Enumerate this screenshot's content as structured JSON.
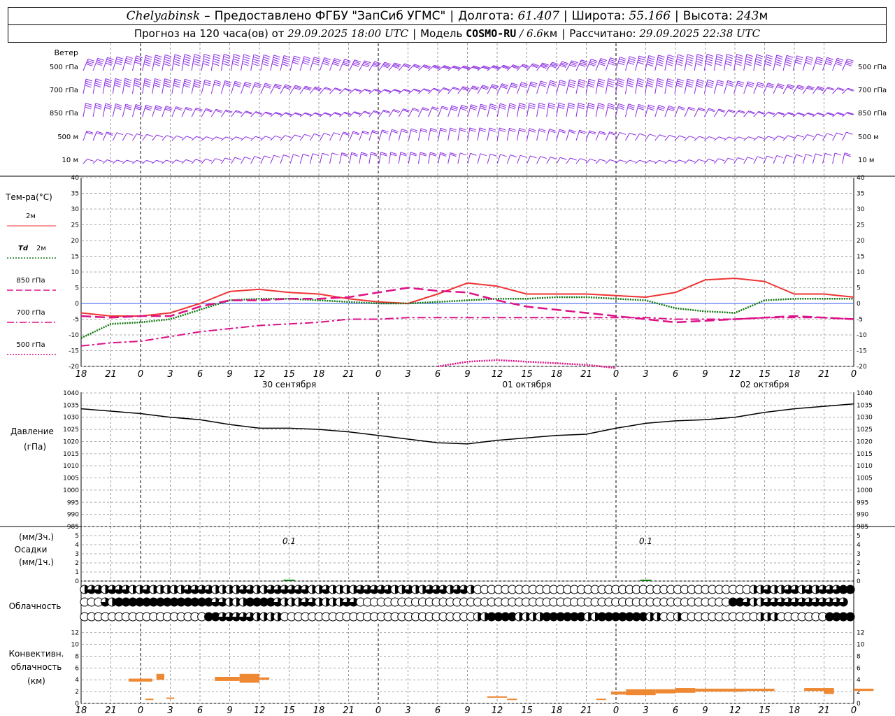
{
  "header": {
    "station": "Chelyabinsk",
    "dash": "–",
    "provider": "Предоставлено ФГБУ \"ЗапСиб УГМС\"",
    "lon_label": "Долгота:",
    "lon_value": "61.407",
    "lat_label": "Широта:",
    "lat_value": "55.166",
    "alt_label": "Высота:",
    "alt_value": "243",
    "alt_unit": "м",
    "forecast_label": "Прогноз на 120 часа(ов) от",
    "forecast_start": "29.09.2025 18:00 UTC",
    "model_label": "Модель",
    "model_name": "COSMO-RU",
    "model_sep": "/",
    "model_res": "6.6",
    "model_res_unit": "км",
    "calc_label": "Рассчитано:",
    "calc_time": "29.09.2025 22:38 UTC"
  },
  "time_axis": {
    "hour_labels": [
      "18",
      "21",
      "0",
      "3",
      "6",
      "9",
      "12",
      "15",
      "18",
      "21",
      "0",
      "3",
      "6",
      "9",
      "12",
      "15",
      "18",
      "21",
      "0",
      "3",
      "6",
      "9",
      "12",
      "15",
      "18",
      "21",
      "0"
    ],
    "dates": [
      "30 сентября",
      "01 октября",
      "02 октября"
    ]
  },
  "wind_panel": {
    "title": "Ветер",
    "levels": [
      {
        "value": "500",
        "unit": "гПа"
      },
      {
        "value": "700",
        "unit": "гПа"
      },
      {
        "value": "850",
        "unit": "гПа"
      },
      {
        "value": "500",
        "unit": "м"
      },
      {
        "value": "10",
        "unit": "м"
      }
    ],
    "color": "#8a2be2"
  },
  "temp_panel": {
    "title": "Тем-ра(°C)",
    "legend": [
      {
        "label": "2м",
        "color": "#ee3333",
        "dash": "solid"
      },
      {
        "label_bold": "Td",
        "label": "2м",
        "color": "#117711",
        "dash": "dotted"
      },
      {
        "label": "850 гПа",
        "color": "#dd1188",
        "dash": "dashed"
      },
      {
        "label": "700 гПа",
        "color": "#dd1188",
        "dash": "dashdot"
      },
      {
        "label": "500 гПа",
        "color": "#dd1188",
        "dash": "dotted"
      }
    ],
    "ticks": [
      "40",
      "35",
      "30",
      "25",
      "20",
      "15",
      "10",
      "5",
      "0",
      "-5",
      "-10",
      "-15",
      "-20"
    ]
  },
  "pressure_panel": {
    "title": "Давление",
    "unit": "(гПа)",
    "ticks": [
      "1040",
      "1035",
      "1030",
      "1025",
      "1020",
      "1015",
      "1010",
      "1005",
      "1000",
      "995",
      "990",
      "985"
    ]
  },
  "precip_panel": {
    "unit_3h": "(мм/3ч.)",
    "title": "Осадки",
    "unit_1h": "(мм/1ч.)",
    "ticks": [
      "5",
      "4",
      "3",
      "2",
      "1",
      "0"
    ],
    "labels": [
      "0.1",
      "0.1"
    ]
  },
  "cloud_panel": {
    "title": "Облачность"
  },
  "conv_panel": {
    "title": "Конвективн.",
    "title2": "облачность",
    "unit": "(км)",
    "ticks": [
      "12",
      "10",
      "8",
      "6",
      "4",
      "2",
      "0"
    ],
    "color": "#ee8833"
  },
  "chart_data": [
    {
      "type": "line",
      "title": "Тем-ра(°C)",
      "x": [
        "18",
        "21",
        "0",
        "3",
        "6",
        "9",
        "12",
        "15",
        "18",
        "21",
        "0",
        "3",
        "6",
        "9",
        "12",
        "15",
        "18",
        "21",
        "0",
        "3",
        "6",
        "9",
        "12",
        "15",
        "18",
        "21",
        "0"
      ],
      "ylim": [
        -20,
        40
      ],
      "series": [
        {
          "name": "2м",
          "values": [
            -3,
            -4,
            -4,
            -3,
            0,
            3.8,
            4.5,
            3.5,
            3,
            1.5,
            0.5,
            0,
            3,
            6.5,
            5.5,
            3,
            3,
            3,
            2.5,
            2,
            3.5,
            7.5,
            8,
            7,
            3,
            3,
            2
          ]
        },
        {
          "name": "Td 2м",
          "values": [
            -11,
            -6.5,
            -6,
            -5,
            -2,
            1,
            1.5,
            1.5,
            1,
            0.5,
            0,
            0,
            0.5,
            1,
            1.5,
            1.5,
            2,
            2,
            1.5,
            1,
            -1.5,
            -2.5,
            -3,
            1,
            1.5,
            1.5,
            1.5
          ]
        },
        {
          "name": "850 гПа",
          "values": [
            -4,
            -4.5,
            -4,
            -4,
            -1,
            1,
            1,
            1.5,
            1.5,
            2,
            3.5,
            5,
            4,
            3.5,
            1,
            -1,
            -2,
            -3,
            -4,
            -5,
            -6,
            -5.5,
            -5,
            -4.5,
            -4,
            -4.5,
            -5
          ]
        },
        {
          "name": "700 гПа",
          "values": [
            -13.5,
            -12.5,
            -12,
            -10.5,
            -9,
            -8,
            -7,
            -6.5,
            -6,
            -5,
            -5,
            -4.5,
            -4.5,
            -4.5,
            -4.5,
            -4.5,
            -4.5,
            -4.5,
            -4.5,
            -4.5,
            -5,
            -5,
            -5,
            -4.5,
            -4.5,
            -4.5,
            -5
          ]
        },
        {
          "name": "500 гПа",
          "values": [
            null,
            null,
            null,
            null,
            null,
            null,
            null,
            null,
            null,
            null,
            null,
            null,
            -20,
            -18.5,
            -18,
            -18.5,
            -19,
            -19.5,
            -20.5,
            null,
            null,
            null,
            null,
            null,
            null,
            null,
            null
          ]
        }
      ]
    },
    {
      "type": "line",
      "title": "Давление",
      "ylabel": "(гПа)",
      "x": [
        "18",
        "21",
        "0",
        "3",
        "6",
        "9",
        "12",
        "15",
        "18",
        "21",
        "0",
        "3",
        "6",
        "9",
        "12",
        "15",
        "18",
        "21",
        "0",
        "3",
        "6",
        "9",
        "12",
        "15",
        "18",
        "21",
        "0"
      ],
      "ylim": [
        985,
        1040
      ],
      "series": [
        {
          "name": "Давление",
          "values": [
            1033.5,
            1032.5,
            1031.5,
            1030,
            1029,
            1027,
            1025.5,
            1025.5,
            1025,
            1024,
            1022.5,
            1021,
            1019.5,
            1019,
            1020.5,
            1021.5,
            1022.5,
            1023,
            1025.5,
            1027.5,
            1028.5,
            1029,
            1030,
            1032,
            1033.5,
            1034.5,
            1035.5
          ]
        }
      ]
    },
    {
      "type": "bar",
      "title": "Осадки",
      "ylabel": "(мм/3ч.)",
      "ylim": [
        0,
        5
      ],
      "points": [
        {
          "x": "15",
          "day": "30 сентября",
          "value": 0.1
        },
        {
          "x": "3",
          "day": "02 октября",
          "value": 0.1
        }
      ]
    },
    {
      "type": "bar",
      "title": "Конвективн. облачность",
      "ylabel": "(км)",
      "ylim": [
        0,
        13
      ],
      "segments": [
        {
          "from": 4.8,
          "to": 7.2,
          "base": 3.7,
          "top": 4.2
        },
        {
          "from": 7.6,
          "to": 8.4,
          "base": 4,
          "top": 5
        },
        {
          "from": 6.5,
          "to": 7.3,
          "base": 0.6,
          "top": 0.8
        },
        {
          "from": 8.6,
          "to": 9.4,
          "base": 0.8,
          "top": 1
        },
        {
          "from": 13.5,
          "to": 16,
          "base": 3.8,
          "top": 4.5
        },
        {
          "from": 16,
          "to": 18,
          "base": 3.5,
          "top": 5
        },
        {
          "from": 18,
          "to": 19,
          "base": 4,
          "top": 4.4
        },
        {
          "from": 41,
          "to": 43,
          "base": 1,
          "top": 1.2
        },
        {
          "from": 43,
          "to": 44,
          "base": 0.6,
          "top": 0.8
        },
        {
          "from": 52,
          "to": 53,
          "base": 0.6,
          "top": 0.8
        },
        {
          "from": 53.5,
          "to": 55,
          "base": 1.5,
          "top": 2
        },
        {
          "from": 55,
          "to": 58,
          "base": 1.4,
          "top": 2.4
        },
        {
          "from": 58,
          "to": 60,
          "base": 1.7,
          "top": 2.4
        },
        {
          "from": 60,
          "to": 62,
          "base": 1.8,
          "top": 2.6
        },
        {
          "from": 62,
          "to": 64,
          "base": 2,
          "top": 2.5
        },
        {
          "from": 64,
          "to": 67,
          "base": 2,
          "top": 2.5
        },
        {
          "from": 67,
          "to": 70,
          "base": 2.1,
          "top": 2.5
        },
        {
          "from": 73,
          "to": 75,
          "base": 2.1,
          "top": 2.6
        },
        {
          "from": 75,
          "to": 76,
          "base": 1.6,
          "top": 2.6
        },
        {
          "from": 78,
          "to": 80,
          "base": 2.1,
          "top": 2.5
        }
      ]
    },
    {
      "type": "table",
      "title": "Облачность",
      "rows": [
        [
          0.5,
          0.75,
          0.75,
          0.5,
          0.75,
          0.75,
          0.75,
          0.5,
          0.5,
          0.75,
          0.5,
          0.5,
          0.5,
          0.5,
          0.5,
          0.75,
          0.75,
          0.75,
          0.75,
          0.5,
          0.5,
          0.5,
          0.5,
          0.75,
          0.75,
          0.5,
          0.5,
          0.75,
          0.75,
          0.75,
          0.75,
          0.75,
          0.75,
          0.5,
          0.5,
          0.75,
          0.5,
          0.5,
          0.5,
          0.5,
          0.75,
          0.75,
          0.75,
          0.75,
          0.75,
          0.5,
          0.5,
          0.75,
          0.5,
          0.5,
          0.75,
          0.75,
          0.75,
          0.5,
          0.75,
          0.75,
          0.5,
          0,
          0,
          0,
          0,
          0,
          0,
          0,
          0,
          0,
          0,
          0,
          0,
          0,
          0,
          0,
          0,
          0,
          0,
          0,
          0,
          0,
          0,
          0,
          0,
          0,
          0,
          0,
          0,
          0,
          0,
          0,
          0,
          0,
          0,
          0,
          0,
          0,
          0,
          0,
          0,
          0.5,
          0.5,
          0.75,
          0.5,
          0.5,
          0.75,
          0.75,
          0.5,
          0.75,
          0.5,
          0.75,
          0.75,
          0.75,
          1,
          1
        ],
        [
          0,
          0,
          0,
          0.75,
          0.5,
          1,
          1,
          1,
          1,
          1,
          1,
          1,
          1,
          1,
          1,
          1,
          1,
          1,
          1,
          0.75,
          0.75,
          0.5,
          0.5,
          0.5,
          1,
          1,
          1,
          1,
          0.75,
          0.5,
          0.5,
          0.5,
          0.75,
          0.75,
          0.5,
          0.5,
          0.5,
          0.5,
          0.75,
          0.75,
          0,
          0,
          0,
          0,
          0,
          0,
          0,
          0,
          0,
          0,
          0,
          0,
          0,
          0,
          0,
          0,
          0,
          0,
          0,
          0,
          0,
          0,
          0,
          0,
          0,
          0,
          0,
          0,
          0,
          0,
          0,
          0,
          0,
          0,
          0,
          0,
          0,
          0,
          0,
          0,
          0,
          0,
          0,
          0,
          0,
          0,
          0,
          0,
          0,
          0,
          0,
          0,
          0,
          0,
          1,
          1,
          0.75,
          0.5,
          0.5,
          0.75,
          0.75,
          0.75,
          0.75,
          0.75,
          0.75,
          0.75,
          0.75,
          0.75,
          0.75,
          0.75,
          0.75
        ],
        [
          0,
          0,
          0,
          0,
          0,
          0,
          0,
          0,
          0,
          0,
          0,
          0,
          0,
          0,
          0,
          0,
          0,
          0,
          1,
          1,
          0.75,
          0.75,
          0.75,
          0.75,
          0.75,
          0.5,
          0.5,
          0.5,
          0.5,
          0,
          0,
          0,
          0,
          0,
          0,
          0,
          0,
          0,
          0,
          0,
          0,
          0,
          0,
          0,
          0,
          0,
          0,
          0,
          0,
          0,
          0,
          0,
          0,
          0,
          0,
          0,
          0,
          0.5,
          0.5,
          1,
          1,
          1,
          1,
          0.5,
          0.5,
          0.5,
          0.5,
          1,
          1,
          1,
          1,
          1,
          1,
          0.5,
          0.5,
          1,
          1,
          1,
          1,
          1,
          1,
          1,
          0.5,
          0.5,
          0,
          0,
          0.5,
          0,
          0,
          0,
          0,
          0,
          0,
          0,
          0,
          0,
          0,
          0,
          0.5,
          0.5,
          0.5,
          0,
          0,
          0,
          0,
          0,
          0,
          0,
          1,
          1,
          1,
          1
        ]
      ]
    }
  ]
}
